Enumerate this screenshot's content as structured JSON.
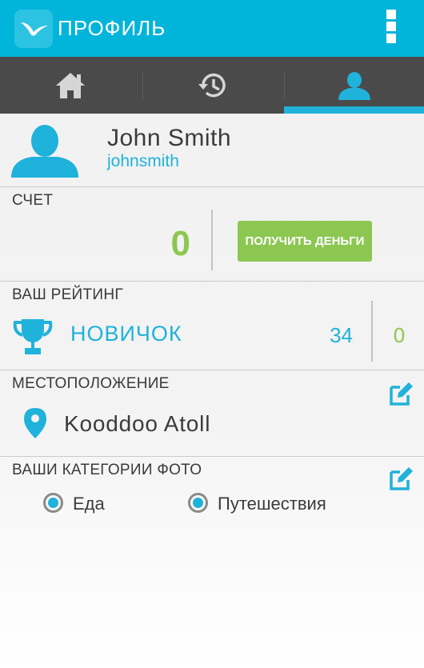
{
  "app_bar": {
    "title": "ПРОФИЛЬ",
    "logo_icon": "seagull-logo-icon",
    "menu_icon": "overflow-menu-icon"
  },
  "tabs": [
    {
      "icon": "home-icon",
      "active": false
    },
    {
      "icon": "history-icon",
      "active": false
    },
    {
      "icon": "profile-icon",
      "active": true
    }
  ],
  "profile": {
    "name": "John Smith",
    "username": "johnsmith",
    "avatar_icon": "user-silhouette-icon"
  },
  "account": {
    "title": "СЧЕТ",
    "balance": "0",
    "button_label": "ПОЛУЧИТЬ ДЕНЬГИ"
  },
  "rating": {
    "title": "ВАШ РЕЙТИНГ",
    "rank": "НОВИЧОК",
    "points": "34",
    "extra": "0",
    "icon": "trophy-icon"
  },
  "location": {
    "title": "МЕСТОПОЛОЖЕНИЕ",
    "value": "Kooddoo Atoll",
    "icon": "map-pin-icon",
    "edit_icon": "edit-icon"
  },
  "categories": {
    "title": "ВАШИ КАТЕГОРИИ ФОТО",
    "edit_icon": "edit-icon",
    "items": [
      {
        "label": "Еда",
        "selected": true
      },
      {
        "label": "Путешествия",
        "selected": true
      }
    ]
  },
  "colors": {
    "primary": "#00b4da",
    "accent": "#1fb2da",
    "green": "#8cc751",
    "tabbar": "#4a4a4a"
  }
}
